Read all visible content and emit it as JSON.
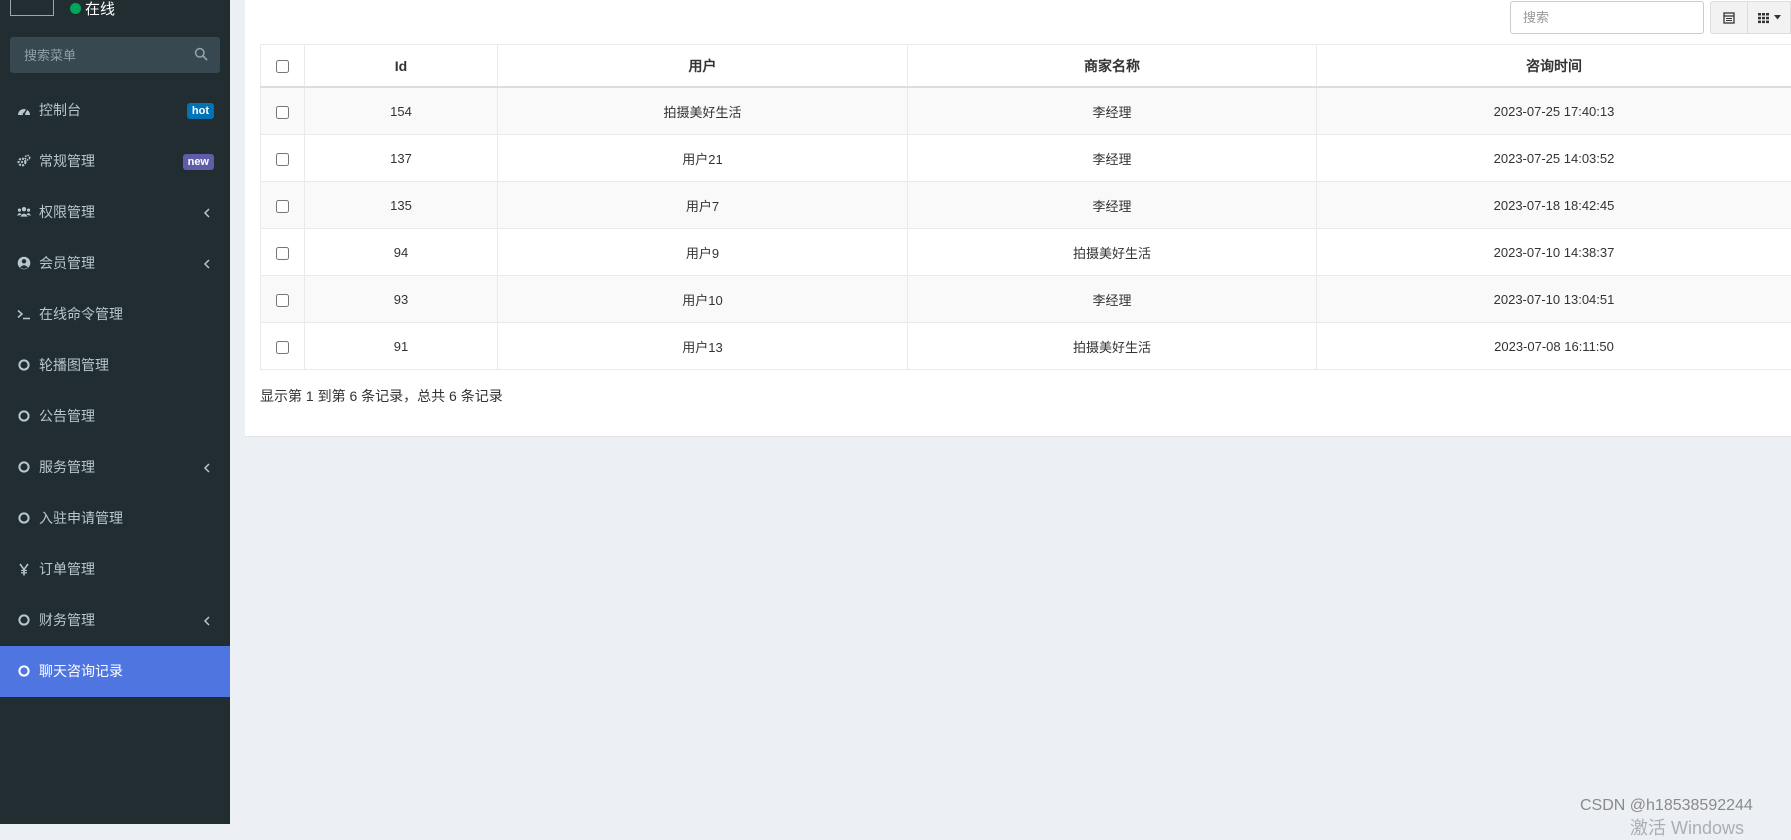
{
  "sidebar": {
    "status_text": "在线",
    "search_placeholder": "搜索菜单",
    "items": [
      {
        "label": "控制台",
        "icon": "dashboard-icon",
        "badge": "hot",
        "badge_color": "#0073b7"
      },
      {
        "label": "常规管理",
        "icon": "cogs-icon",
        "badge": "new",
        "badge_color": "#605ca8"
      },
      {
        "label": "权限管理",
        "icon": "users-icon",
        "has_submenu": true
      },
      {
        "label": "会员管理",
        "icon": "user-circle-icon",
        "has_submenu": true
      },
      {
        "label": "在线命令管理",
        "icon": "terminal-icon"
      },
      {
        "label": "轮播图管理",
        "icon": "circle-o-icon"
      },
      {
        "label": "公告管理",
        "icon": "circle-o-icon"
      },
      {
        "label": "服务管理",
        "icon": "circle-o-icon",
        "has_submenu": true
      },
      {
        "label": "入驻申请管理",
        "icon": "circle-o-icon"
      },
      {
        "label": "订单管理",
        "icon": "yen-icon"
      },
      {
        "label": "财务管理",
        "icon": "circle-o-icon",
        "has_submenu": true
      },
      {
        "label": "聊天咨询记录",
        "icon": "circle-o-icon",
        "active": true
      }
    ]
  },
  "toolbar": {
    "search_placeholder": "搜索"
  },
  "table": {
    "headers": [
      "Id",
      "用户",
      "商家名称",
      "咨询时间"
    ],
    "rows": [
      {
        "id": "154",
        "user": "拍摄美好生活",
        "merchant": "李经理",
        "time": "2023-07-25 17:40:13"
      },
      {
        "id": "137",
        "user": "用户21",
        "merchant": "李经理",
        "time": "2023-07-25 14:03:52"
      },
      {
        "id": "135",
        "user": "用户7",
        "merchant": "李经理",
        "time": "2023-07-18 18:42:45"
      },
      {
        "id": "94",
        "user": "用户9",
        "merchant": "拍摄美好生活",
        "time": "2023-07-10 14:38:37"
      },
      {
        "id": "93",
        "user": "用户10",
        "merchant": "李经理",
        "time": "2023-07-10 13:04:51"
      },
      {
        "id": "91",
        "user": "用户13",
        "merchant": "拍摄美好生活",
        "time": "2023-07-08 16:11:50"
      }
    ]
  },
  "pagination": {
    "info": "显示第 1 到第 6 条记录，总共 6 条记录"
  },
  "watermark": "CSDN @h18538592244",
  "activate_windows": "激活 Windows"
}
